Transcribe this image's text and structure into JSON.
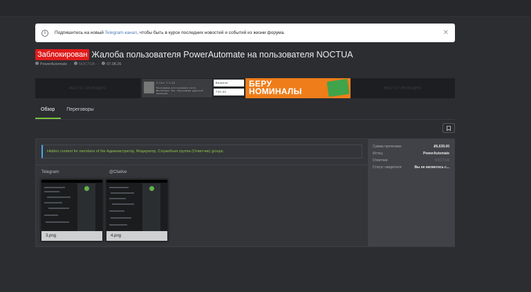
{
  "notice": {
    "text_before": "Подпишитесь на новый ",
    "link": "Telegram-канал",
    "text_after": ", чтобы быть в курсе последних новостей и событий из жизни форума."
  },
  "thread": {
    "badge": "Заблокирован",
    "title": "Жалоба пользователя PowerAutomate на пользователя NOCTUA",
    "author": "PowerAutomate",
    "target": "NOCTUA",
    "date": "07.08.26"
  },
  "banners": {
    "placeholder1": "МЕСТО СВОБОДНО",
    "card_name": "S.Che",
    "card_sub": "2.0.46",
    "card_desc": "Программа для проверки сеток Blockchain info. Программа адресов/проверки",
    "balance_label": "Balance",
    "balance_value": "700.00",
    "promo": [
      "БЕРУ",
      "НОМИНАЛЫ"
    ],
    "placeholder2": "МЕСТО СВОБОДНО"
  },
  "tabs": [
    {
      "label": "Обзор",
      "active": true
    },
    {
      "label": "Переговоры",
      "active": false
    }
  ],
  "content": {
    "hidden_text": "Hidden content for members of the Администратор, Модератор, Служебная группа (Ответчик) groups.",
    "telegram_label": "Telegram:",
    "handle_label": "@Clialive",
    "attachments": [
      {
        "caption": "3.png"
      },
      {
        "caption": "4.png"
      }
    ]
  },
  "sidebar": {
    "rows": [
      {
        "key": "Сумма претензии:",
        "value": "₽6,639.00"
      },
      {
        "key": "Истец:",
        "value": "PowerAutomate"
      },
      {
        "key": "Ответчик:",
        "value": "NOCTUA"
      },
      {
        "key": "Статус свидетеля:",
        "value": "Вы не являетесь с..."
      }
    ]
  },
  "colors": {
    "accent_green": "#7bc043",
    "badge_red": "#e01b1b",
    "info_blue": "#47a7eb"
  }
}
